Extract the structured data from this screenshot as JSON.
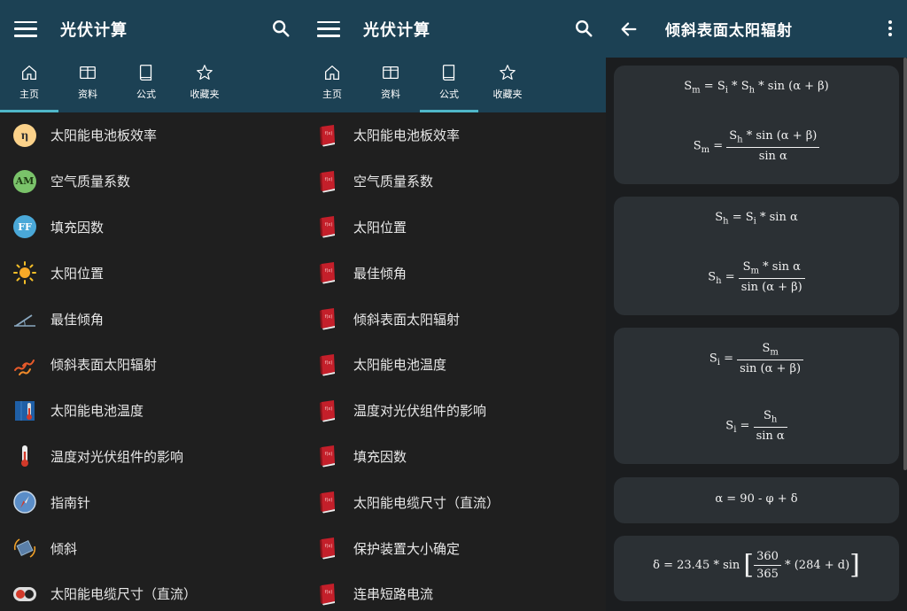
{
  "left_panel": {
    "title": "光伏计算",
    "tabs": [
      {
        "label": "主页",
        "icon": "home-icon",
        "active": true
      },
      {
        "label": "资料",
        "icon": "book-open-icon",
        "active": false
      },
      {
        "label": "公式",
        "icon": "book-icon",
        "active": false
      },
      {
        "label": "收藏夹",
        "icon": "star-icon",
        "active": false
      }
    ],
    "items": [
      {
        "label": "太阳能电池板效率",
        "icon": "eta-icon",
        "glyph": "η"
      },
      {
        "label": "空气质量系数",
        "icon": "am-icon",
        "glyph": "AM"
      },
      {
        "label": "填充因数",
        "icon": "ff-icon",
        "glyph": "FF"
      },
      {
        "label": "太阳位置",
        "icon": "sun-icon"
      },
      {
        "label": "最佳倾角",
        "icon": "tilt-angle-icon"
      },
      {
        "label": "倾斜表面太阳辐射",
        "icon": "radiation-icon"
      },
      {
        "label": "太阳能电池温度",
        "icon": "panel-thermometer-icon"
      },
      {
        "label": "温度对光伏组件的影响",
        "icon": "thermometer-icon"
      },
      {
        "label": "指南针",
        "icon": "compass-icon"
      },
      {
        "label": "倾斜",
        "icon": "inclination-icon"
      },
      {
        "label": "太阳能电缆尺寸（直流）",
        "icon": "cable-icon"
      }
    ]
  },
  "middle_panel": {
    "title": "光伏计算",
    "tabs": [
      {
        "label": "主页",
        "icon": "home-icon",
        "active": false
      },
      {
        "label": "资料",
        "icon": "book-open-icon",
        "active": false
      },
      {
        "label": "公式",
        "icon": "book-icon",
        "active": true
      },
      {
        "label": "收藏夹",
        "icon": "star-icon",
        "active": false
      }
    ],
    "items": [
      {
        "label": "太阳能电池板效率"
      },
      {
        "label": "空气质量系数"
      },
      {
        "label": "太阳位置"
      },
      {
        "label": "最佳倾角"
      },
      {
        "label": "倾斜表面太阳辐射"
      },
      {
        "label": "太阳能电池温度"
      },
      {
        "label": "温度对光伏组件的影响"
      },
      {
        "label": "填充因数"
      },
      {
        "label": "太阳能电缆尺寸（直流）"
      },
      {
        "label": "保护装置大小确定"
      },
      {
        "label": "连串短路电流"
      }
    ]
  },
  "right_panel": {
    "title": "倾斜表面太阳辐射",
    "formulas": {
      "c1_sm": "S",
      "c1_sm_sub": "m",
      "c1_eq": " = ",
      "c1_si": "S",
      "c1_si_sub": "i",
      "c1_mul1": " * ",
      "c1_sh": "S",
      "c1_sh_sub": "h",
      "c1_rest": " * sin (α + β)",
      "c1b_lhs": "S",
      "c1b_lhs_sub": "m",
      "c1b_eq": " = ",
      "c1b_num_s": "S",
      "c1b_num_sub": "h",
      "c1b_num_rest": " * sin (α + β)",
      "c1b_den": "sin α",
      "c2_lhs": "S",
      "c2_lhs_sub": "h",
      "c2_eq": " = ",
      "c2_s": "S",
      "c2_s_sub": "i",
      "c2_rest": " * sin α",
      "c2b_lhs": "S",
      "c2b_lhs_sub": "h",
      "c2b_eq": " = ",
      "c2b_num_s": "S",
      "c2b_num_sub": "m",
      "c2b_num_rest": " * sin α",
      "c2b_den": "sin (α + β)",
      "c3_lhs": "S",
      "c3_lhs_sub": "i",
      "c3_eq": " = ",
      "c3_num_s": "S",
      "c3_num_sub": "m",
      "c3_den": "sin (α + β)",
      "c3b_lhs": "S",
      "c3b_lhs_sub": "i",
      "c3b_eq": " = ",
      "c3b_num_s": "S",
      "c3b_num_sub": "h",
      "c3b_den": "sin α",
      "c4": "α = 90 - φ + δ",
      "c5_lhs": "δ = 23.45 * sin ",
      "c5_lb": "[",
      "c5_num": "360",
      "c5_den": "365",
      "c5_rest": " * (284 + d)",
      "c5_rb": "]"
    }
  },
  "colors": {
    "appbar": "#1c4154",
    "accent": "#4fb7c9",
    "background": "#1f1f1f",
    "card": "#2b3034"
  }
}
